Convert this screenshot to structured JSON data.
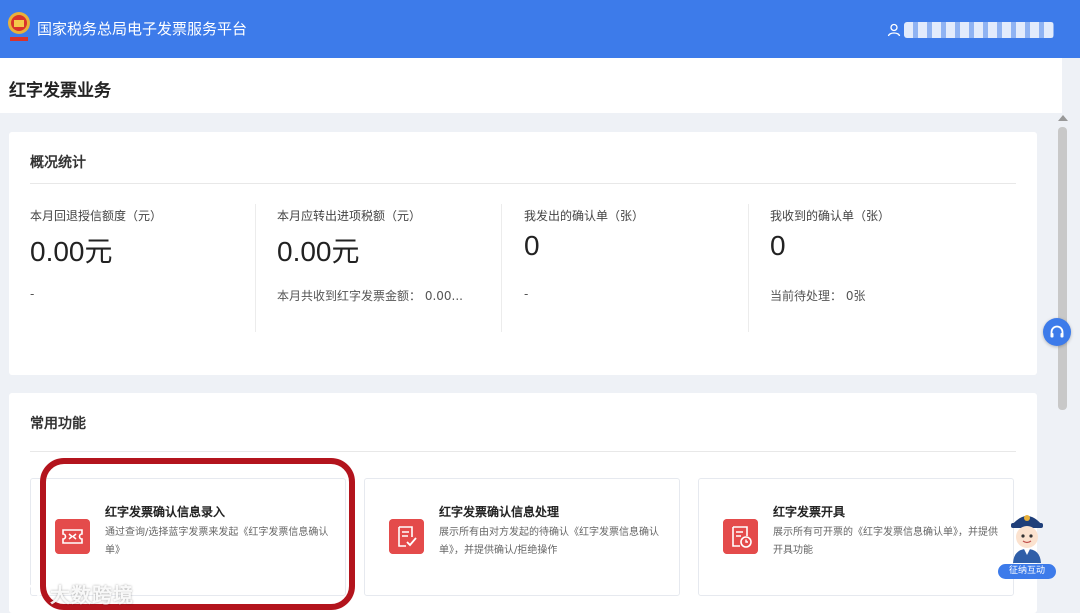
{
  "app": {
    "title": "国家税务总局电子发票服务平台"
  },
  "user": {
    "name": ""
  },
  "page": {
    "title": "红字发票业务"
  },
  "overview": {
    "title": "概况统计",
    "stats": [
      {
        "label": "本月回退授信额度（元）",
        "value": "0.00元",
        "sub": "-"
      },
      {
        "label": "本月应转出进项税额（元）",
        "value": "0.00元",
        "sub": "本月共收到红字发票金额： 0.00..."
      },
      {
        "label": "我发出的确认单（张）",
        "value": "0",
        "sub": "-"
      },
      {
        "label": "我收到的确认单（张）",
        "value": "0",
        "sub": "当前待处理： 0张"
      }
    ]
  },
  "functions": {
    "title": "常用功能",
    "items": [
      {
        "title": "红字发票确认信息录入",
        "desc": "通过查询/选择蓝字发票来发起《红字发票信息确认单》"
      },
      {
        "title": "红字发票确认信息处理",
        "desc": "展示所有由对方发起的待确认《红字发票信息确认单》，并提供确认/拒绝操作"
      },
      {
        "title": "红字发票开具",
        "desc": "展示所有可开票的《红字发票信息确认单》，并提供开具功能"
      }
    ]
  },
  "assistant": {
    "label": "征纳互动"
  },
  "watermark": {
    "text": "大数跨境"
  },
  "colors": {
    "primary": "#3d7bea",
    "icon_red": "#e44b4b",
    "highlight": "#b3141d"
  },
  "icons": [
    "emblem-icon",
    "user-icon",
    "headset-icon",
    "ticket-icon",
    "doc-check-icon",
    "doc-clock-icon",
    "assistant-avatar-icon",
    "watermark-logo-icon"
  ]
}
